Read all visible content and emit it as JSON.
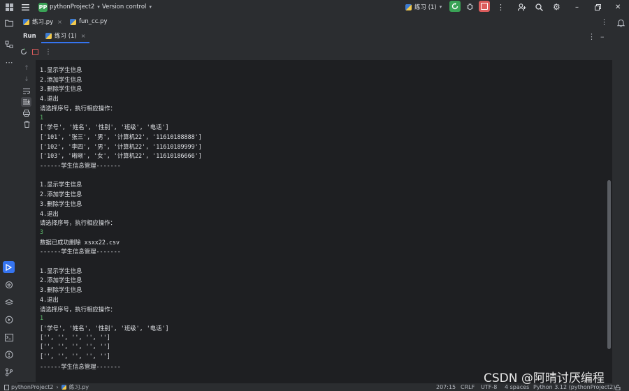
{
  "titlebar": {
    "badge": "PP",
    "project": "pythonProject2",
    "vcs": "Version control",
    "run_config": "练习 (1)"
  },
  "file_tabs": [
    {
      "label": "练习.py"
    },
    {
      "label": "fun_cc.py"
    }
  ],
  "run_panel": {
    "title": "Run",
    "tab": "练习 (1)"
  },
  "console_lines": [
    {
      "text": "1.显示学生信息"
    },
    {
      "text": "2.添加学生信息"
    },
    {
      "text": "3.删除学生信息"
    },
    {
      "text": "4.退出"
    },
    {
      "text": "请选择序号，执行相应操作："
    },
    {
      "text": "1",
      "input": true
    },
    {
      "text": "['学号', '姓名', '性别', '班级', '电话']"
    },
    {
      "text": "['101', '张三', '男', '计算机22', '11610188888']"
    },
    {
      "text": "['102', '李四', '男', '计算机22', '11610189999']"
    },
    {
      "text": "['103', '晰晰', '女', '计算机22', '11610186666']"
    },
    {
      "text": "------学生信息管理-------"
    },
    {
      "text": ""
    },
    {
      "text": "1.显示学生信息"
    },
    {
      "text": "2.添加学生信息"
    },
    {
      "text": "3.删除学生信息"
    },
    {
      "text": "4.退出"
    },
    {
      "text": "请选择序号，执行相应操作："
    },
    {
      "text": "3",
      "input": true
    },
    {
      "text": "数据已成功删除 xsxx22.csv"
    },
    {
      "text": "------学生信息管理-------"
    },
    {
      "text": ""
    },
    {
      "text": "1.显示学生信息"
    },
    {
      "text": "2.添加学生信息"
    },
    {
      "text": "3.删除学生信息"
    },
    {
      "text": "4.退出"
    },
    {
      "text": "请选择序号，执行相应操作："
    },
    {
      "text": "1",
      "input": true
    },
    {
      "text": "['学号', '姓名', '性别', '班级', '电话']"
    },
    {
      "text": "['', '', '', '', '']"
    },
    {
      "text": "['', '', '', '', '']"
    },
    {
      "text": "['', '', '', '', '']"
    },
    {
      "text": "------学生信息管理-------"
    }
  ],
  "statusbar": {
    "project": "pythonProject2",
    "file": "练习.py",
    "position": "207:15",
    "line_sep": "CRLF",
    "encoding": "UTF-8",
    "indent": "4 spaces",
    "interpreter": "Python 3.12 (pythonProject2)"
  },
  "watermark": "CSDN @阿晴讨厌编程",
  "colors": {
    "accent": "#3574f0",
    "run_green": "#3aa356",
    "stop_red": "#db5c5c",
    "console_input": "#5fb86c"
  }
}
